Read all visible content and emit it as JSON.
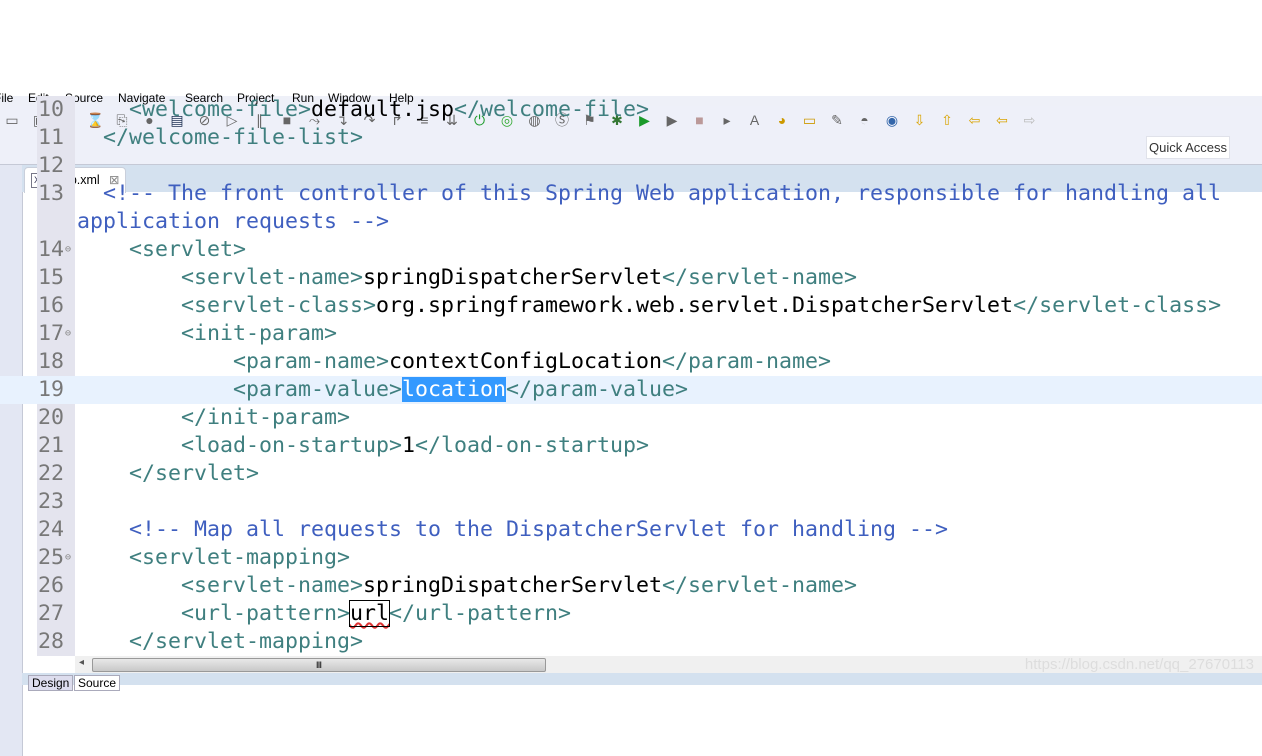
{
  "menu": [
    "File",
    "Edit",
    "Source",
    "Navigate",
    "Search",
    "Project",
    "Run",
    "Window",
    "Help"
  ],
  "toolbar": {
    "icons": [
      "new-icon",
      "save-icon",
      "save-all-icon",
      "print-icon",
      "open-type-icon",
      "user-icon",
      "console-icon",
      "skip-breakpoints-icon",
      "resume-icon",
      "suspend-icon",
      "terminate-icon",
      "disconnect-icon",
      "step-into-icon",
      "step-over-icon",
      "step-return-icon",
      "drop-frame-icon",
      "use-step-filters-icon",
      "spring-boot-icon",
      "spring-dashboard-icon",
      "new-web-icon",
      "spring-icon",
      "run-server-icon",
      "debug-icon",
      "run-icon",
      "external-tools-icon",
      "stop-icon",
      "coverage-icon",
      "search-annotations-icon",
      "open-project-icon",
      "open-folder-icon",
      "pen-icon",
      "open-task-icon",
      "globe-icon",
      "next-annotation-icon",
      "prev-annotation-icon",
      "last-edit-icon",
      "back-icon",
      "forward-icon"
    ],
    "quick_access": "Quick Access"
  },
  "editor": {
    "tab_label": "*web.xml",
    "current_line": 19,
    "lines": [
      {
        "n": "10",
        "s": [
          [
            "t",
            "    "
          ],
          [
            "tag",
            "<welcome-file>"
          ],
          [
            "t",
            "default.jsp"
          ],
          [
            "tag",
            "</welcome-file>"
          ]
        ]
      },
      {
        "n": "11",
        "s": [
          [
            "t",
            "  "
          ],
          [
            "tag",
            "</welcome-file-list>"
          ]
        ]
      },
      {
        "n": "12",
        "s": []
      },
      {
        "n": "13",
        "s": [
          [
            "t",
            "  "
          ],
          [
            "c",
            "<!-- The front controller of this Spring Web application, responsible for handling all application requests -->"
          ]
        ]
      },
      {
        "n": "14",
        "f": true,
        "s": [
          [
            "t",
            "    "
          ],
          [
            "tag",
            "<servlet>"
          ]
        ]
      },
      {
        "n": "15",
        "s": [
          [
            "t",
            "        "
          ],
          [
            "tag",
            "<servlet-name>"
          ],
          [
            "t",
            "springDispatcherServlet"
          ],
          [
            "tag",
            "</servlet-name>"
          ]
        ]
      },
      {
        "n": "16",
        "s": [
          [
            "t",
            "        "
          ],
          [
            "tag",
            "<servlet-class>"
          ],
          [
            "t",
            "org.springframework.web.servlet.DispatcherServlet"
          ],
          [
            "tag",
            "</servlet-class>"
          ]
        ]
      },
      {
        "n": "17",
        "f": true,
        "s": [
          [
            "t",
            "        "
          ],
          [
            "tag",
            "<init-param>"
          ]
        ]
      },
      {
        "n": "18",
        "s": [
          [
            "t",
            "            "
          ],
          [
            "tag",
            "<param-name>"
          ],
          [
            "t",
            "contextConfigLocation"
          ],
          [
            "tag",
            "</param-name>"
          ]
        ]
      },
      {
        "n": "19",
        "s": [
          [
            "t",
            "            "
          ],
          [
            "tag",
            "<param-value>"
          ],
          [
            "sel",
            "location"
          ],
          [
            "tag",
            "</param-value>"
          ]
        ]
      },
      {
        "n": "20",
        "s": [
          [
            "t",
            "        "
          ],
          [
            "tag",
            "</init-param>"
          ]
        ]
      },
      {
        "n": "21",
        "s": [
          [
            "t",
            "        "
          ],
          [
            "tag",
            "<load-on-startup>"
          ],
          [
            "t",
            "1"
          ],
          [
            "tag",
            "</load-on-startup>"
          ]
        ]
      },
      {
        "n": "22",
        "s": [
          [
            "t",
            "    "
          ],
          [
            "tag",
            "</servlet>"
          ]
        ]
      },
      {
        "n": "23",
        "s": []
      },
      {
        "n": "24",
        "s": [
          [
            "t",
            "    "
          ],
          [
            "c",
            "<!-- Map all requests to the DispatcherServlet for handling -->"
          ]
        ]
      },
      {
        "n": "25",
        "f": true,
        "s": [
          [
            "t",
            "    "
          ],
          [
            "tag",
            "<servlet-mapping>"
          ]
        ]
      },
      {
        "n": "26",
        "s": [
          [
            "t",
            "        "
          ],
          [
            "tag",
            "<servlet-name>"
          ],
          [
            "t",
            "springDispatcherServlet"
          ],
          [
            "tag",
            "</servlet-name>"
          ]
        ]
      },
      {
        "n": "27",
        "s": [
          [
            "t",
            "        "
          ],
          [
            "tag",
            "<url-pattern>"
          ],
          [
            "sq",
            "url"
          ],
          [
            "tag",
            "</url-pattern>"
          ]
        ]
      },
      {
        "n": "28",
        "s": [
          [
            "t",
            "    "
          ],
          [
            "tag",
            "</servlet-mapping>"
          ]
        ]
      }
    ]
  },
  "bottom_tabs": [
    "Design",
    "Source"
  ],
  "watermark": "https://blog.csdn.net/qq_27670113",
  "colors": {
    "tag": "#3f7f7f",
    "comment": "#3f5fbf",
    "selection": "#3399ff",
    "current_line": "#e8f2fe"
  }
}
